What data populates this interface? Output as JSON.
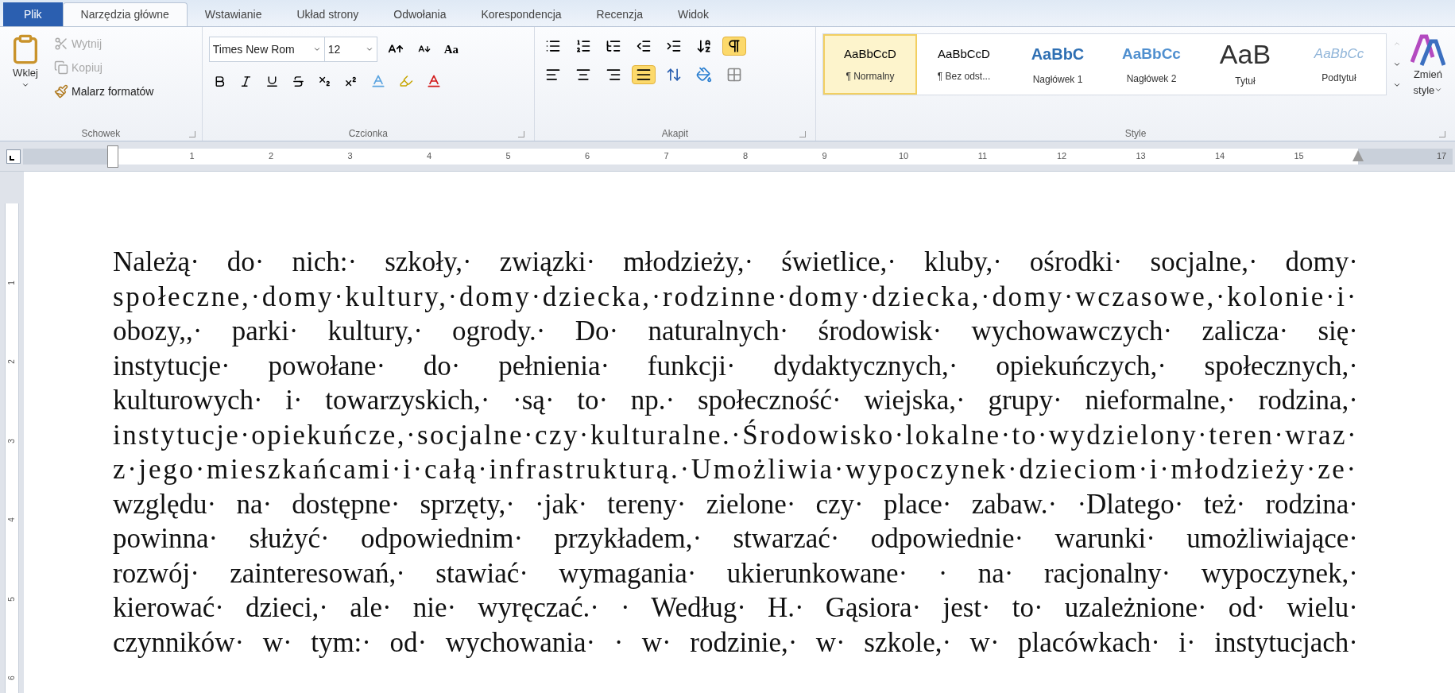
{
  "tabs": [
    {
      "label": "Plik",
      "kind": "file",
      "selected": false
    },
    {
      "label": "Narzędzia główne",
      "kind": "tab",
      "selected": true
    },
    {
      "label": "Wstawianie",
      "kind": "tab",
      "selected": false
    },
    {
      "label": "Układ strony",
      "kind": "tab",
      "selected": false
    },
    {
      "label": "Odwołania",
      "kind": "tab",
      "selected": false
    },
    {
      "label": "Korespondencja",
      "kind": "tab",
      "selected": false
    },
    {
      "label": "Recenzja",
      "kind": "tab",
      "selected": false
    },
    {
      "label": "Widok",
      "kind": "tab",
      "selected": false
    }
  ],
  "clipboard": {
    "label": "Schowek",
    "paste": "Wklej",
    "items": [
      {
        "label": "Wytnij",
        "kind": "cut",
        "disabled": true
      },
      {
        "label": "Kopiuj",
        "kind": "copy",
        "disabled": true
      },
      {
        "label": "Malarz formatów",
        "kind": "painter",
        "disabled": false
      }
    ]
  },
  "font": {
    "label": "Czcionka",
    "font_name": "Times New Rom",
    "font_size": "12",
    "change_case": "Aa"
  },
  "paragraph": {
    "label": "Akapit",
    "show_marks": true,
    "alignment": [
      {
        "kind": "left",
        "selected": false
      },
      {
        "kind": "center",
        "selected": false
      },
      {
        "kind": "right",
        "selected": false
      },
      {
        "kind": "justify",
        "selected": true
      }
    ]
  },
  "styles": {
    "label": "Style",
    "items": [
      {
        "sample": "AaBbCcD",
        "name": "¶ Normalny",
        "kind": "normal",
        "selected": true
      },
      {
        "sample": "AaBbCcD",
        "name": "¶ Bez odst...",
        "kind": "normal",
        "selected": false
      },
      {
        "sample": "AaBbC",
        "name": "Nagłówek 1",
        "kind": "heading1",
        "selected": false
      },
      {
        "sample": "AaBbCc",
        "name": "Nagłówek 2",
        "kind": "heading2",
        "selected": false
      },
      {
        "sample": "AaB",
        "name": "Tytuł",
        "kind": "title",
        "selected": false
      },
      {
        "sample": "AaBbCc",
        "name": "Podtytuł",
        "kind": "subtitle",
        "selected": false
      }
    ],
    "change_styles": [
      "Zmień",
      "style"
    ]
  },
  "ruler": {
    "numbers": [
      {
        "label": "1",
        "shaded": false
      },
      {
        "label": "2",
        "shaded": false
      },
      {
        "label": "3",
        "shaded": false
      },
      {
        "label": "4",
        "shaded": false
      },
      {
        "label": "5",
        "shaded": false
      },
      {
        "label": "6",
        "shaded": false
      },
      {
        "label": "7",
        "shaded": false
      },
      {
        "label": "8",
        "shaded": false
      },
      {
        "label": "9",
        "shaded": false
      },
      {
        "label": "10",
        "shaded": false
      },
      {
        "label": "11",
        "shaded": false
      },
      {
        "label": "12",
        "shaded": false
      },
      {
        "label": "13",
        "shaded": false
      },
      {
        "label": "14",
        "shaded": false
      },
      {
        "label": "15",
        "shaded": false
      },
      {
        "label": "17",
        "shaded": true
      }
    ],
    "vertical_numbers": [
      "1",
      "2",
      "3",
      "4",
      "5",
      "6"
    ]
  },
  "document": {
    "lines": [
      "Należą· do· nich:· szkoły,· związki· młodzieży,· świetlice,· kluby,· ośrodki· socjalne,· domy·",
      "społeczne,·domy·kultury,·domy·dziecka,·rodzinne·domy·dziecka,·domy·wczasowe,·kolonie·i·",
      "obozy,,· parki· kultury,· ogrody.· Do· naturalnych· środowisk· wychowawczych· zalicza· się·",
      "instytucje· powołane· do· pełnienia· funkcji· dydaktycznych,· opiekuńczych,· społecznych,·",
      "kulturowych· i· towarzyskich,· ·są· to· np.· społeczność· wiejska,· grupy· nieformalne,· rodzina,·",
      "instytucje·opiekuńcze,·socjalne·czy·kulturalne.·Środowisko·lokalne·to·wydzielony·teren·wraz·",
      "z·jego·mieszkańcami·i·całą·infrastrukturą.·Umożliwia·wypoczynek·dzieciom·i·młodzieży·ze·",
      "względu· na· dostępne· sprzęty,· ·jak· tereny· zielone· czy· place· zabaw.· ·Dlatego· też· rodzina·",
      "powinna· służyć· odpowiednim· przykładem,· stwarzać· odpowiednie· warunki· umożliwiające·",
      "rozwój· zainteresowań,· stawiać· wymagania· ukierunkowane· · na· racjonalny· wypoczynek,·",
      "kierować· dzieci,· ale· nie· wyręczać.· · Według· H.· Gąsiora· jest· to· uzależnione· od· wielu·",
      "czynników· w· tym:· od· wychowania· · w· rodzinie,· w· szkole,· w· placówkach· i· instytucjach·"
    ]
  }
}
